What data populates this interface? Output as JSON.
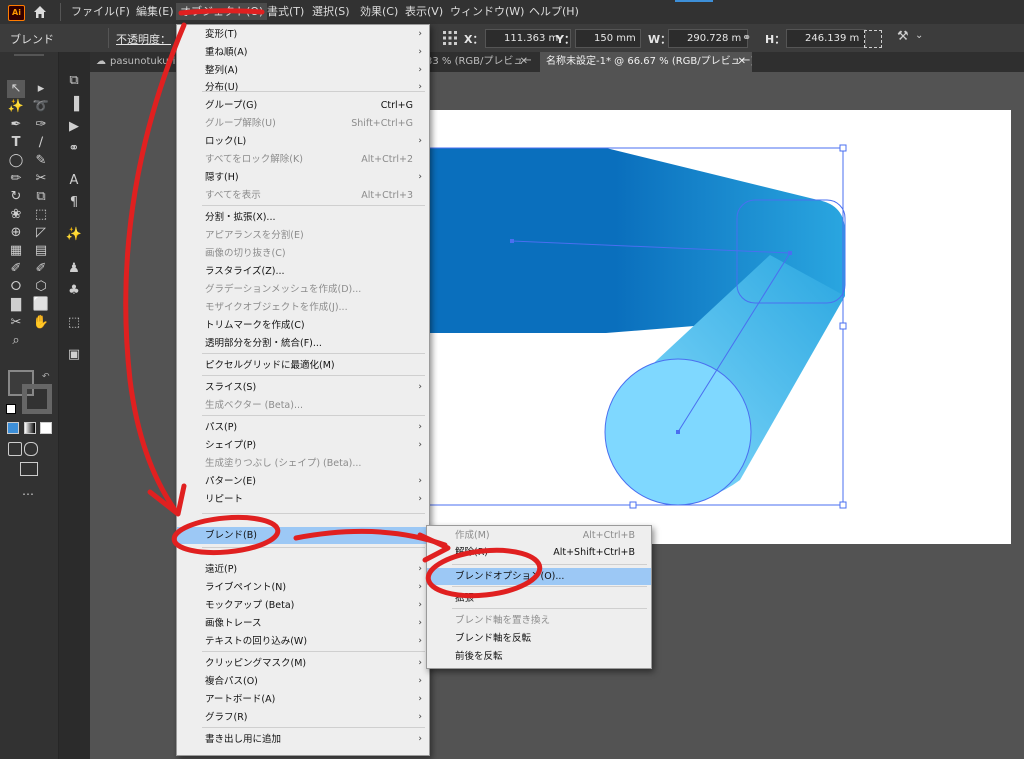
{
  "menubar": {
    "app_icon": "Ai",
    "items": [
      "ファイル(F)",
      "編集(E)",
      "オブジェクト(O)",
      "書式(T)",
      "選択(S)",
      "効果(C)",
      "表示(V)",
      "ウィンドウ(W)",
      "ヘルプ(H)"
    ]
  },
  "control_bar": {
    "mode_label": "ブレンド",
    "opacity_label": "不透明度：",
    "x_label": "X：",
    "x_value": "111.363 m",
    "y_label": "Y：",
    "y_value": "150 mm",
    "w_label": "W：",
    "w_value": "290.728 m",
    "h_label": "H：",
    "h_value": "246.139 m"
  },
  "tabs": [
    {
      "label": "pasunotukuri",
      "active": false
    },
    {
      "label": "33 % (RGB/プレビュー)",
      "active": false
    },
    {
      "label": "名称未設定-1* @ 66.67 % (RGB/プレビュー)",
      "active": true
    }
  ],
  "object_menu": {
    "items": [
      {
        "label": "変形(T)",
        "shortcut": "",
        "submenu": true,
        "disabled": false
      },
      {
        "label": "重ね順(A)",
        "shortcut": "",
        "submenu": true,
        "disabled": false
      },
      {
        "label": "整列(A)",
        "shortcut": "",
        "submenu": true,
        "disabled": false
      },
      {
        "label": "分布(U)",
        "shortcut": "",
        "submenu": true,
        "disabled": false
      },
      {
        "label": "グループ(G)",
        "shortcut": "Ctrl+G",
        "submenu": false,
        "disabled": false
      },
      {
        "label": "グループ解除(U)",
        "shortcut": "Shift+Ctrl+G",
        "submenu": false,
        "disabled": true
      },
      {
        "label": "ロック(L)",
        "shortcut": "",
        "submenu": true,
        "disabled": false
      },
      {
        "label": "すべてをロック解除(K)",
        "shortcut": "Alt+Ctrl+2",
        "submenu": false,
        "disabled": true
      },
      {
        "label": "隠す(H)",
        "shortcut": "",
        "submenu": true,
        "disabled": false
      },
      {
        "label": "すべてを表示",
        "shortcut": "Alt+Ctrl+3",
        "submenu": false,
        "disabled": true
      },
      {
        "label": "分割・拡張(X)...",
        "shortcut": "",
        "submenu": false,
        "disabled": false
      },
      {
        "label": "アピアランスを分割(E)",
        "shortcut": "",
        "submenu": false,
        "disabled": true
      },
      {
        "label": "画像の切り抜き(C)",
        "shortcut": "",
        "submenu": false,
        "disabled": true
      },
      {
        "label": "ラスタライズ(Z)...",
        "shortcut": "",
        "submenu": false,
        "disabled": false
      },
      {
        "label": "グラデーションメッシュを作成(D)...",
        "shortcut": "",
        "submenu": false,
        "disabled": true
      },
      {
        "label": "モザイクオブジェクトを作成(J)...",
        "shortcut": "",
        "submenu": false,
        "disabled": true
      },
      {
        "label": "トリムマークを作成(C)",
        "shortcut": "",
        "submenu": false,
        "disabled": false
      },
      {
        "label": "透明部分を分割・統合(F)...",
        "shortcut": "",
        "submenu": false,
        "disabled": false
      },
      {
        "label": "ピクセルグリッドに最適化(M)",
        "shortcut": "",
        "submenu": false,
        "disabled": false
      },
      {
        "label": "スライス(S)",
        "shortcut": "",
        "submenu": true,
        "disabled": false
      },
      {
        "label": "生成ベクター (Beta)...",
        "shortcut": "",
        "submenu": false,
        "disabled": true
      },
      {
        "label": "パス(P)",
        "shortcut": "",
        "submenu": true,
        "disabled": false
      },
      {
        "label": "シェイプ(P)",
        "shortcut": "",
        "submenu": true,
        "disabled": false
      },
      {
        "label": "生成塗りつぶし (シェイプ) (Beta)...",
        "shortcut": "",
        "submenu": false,
        "disabled": true
      },
      {
        "label": "パターン(E)",
        "shortcut": "",
        "submenu": true,
        "disabled": false
      },
      {
        "label": "リピート",
        "shortcut": "",
        "submenu": true,
        "disabled": false
      },
      {
        "label": "ブレンド(B)",
        "shortcut": "",
        "submenu": true,
        "disabled": false,
        "highlighted": true
      },
      {
        "label": "遠近(P)",
        "shortcut": "",
        "submenu": true,
        "disabled": false
      },
      {
        "label": "ライブペイント(N)",
        "shortcut": "",
        "submenu": true,
        "disabled": false
      },
      {
        "label": "モックアップ (Beta)",
        "shortcut": "",
        "submenu": true,
        "disabled": false
      },
      {
        "label": "画像トレース",
        "shortcut": "",
        "submenu": true,
        "disabled": false
      },
      {
        "label": "テキストの回り込み(W)",
        "shortcut": "",
        "submenu": true,
        "disabled": false
      },
      {
        "label": "クリッピングマスク(M)",
        "shortcut": "",
        "submenu": true,
        "disabled": false
      },
      {
        "label": "複合パス(O)",
        "shortcut": "",
        "submenu": true,
        "disabled": false
      },
      {
        "label": "アートボード(A)",
        "shortcut": "",
        "submenu": true,
        "disabled": false
      },
      {
        "label": "グラフ(R)",
        "shortcut": "",
        "submenu": true,
        "disabled": false
      },
      {
        "label": "書き出し用に追加",
        "shortcut": "",
        "submenu": true,
        "disabled": false
      }
    ]
  },
  "blend_submenu": {
    "items": [
      {
        "label": "作成(M)",
        "shortcut": "Alt+Ctrl+B",
        "disabled": true
      },
      {
        "label": "解除(R)",
        "shortcut": "Alt+Shift+Ctrl+B",
        "disabled": false
      },
      {
        "label": "ブレンドオプション(O)...",
        "shortcut": "",
        "disabled": false,
        "highlighted": true
      },
      {
        "label": "拡張",
        "shortcut": "",
        "disabled": false
      },
      {
        "label": "ブレンド軸を置き換え",
        "shortcut": "",
        "disabled": true
      },
      {
        "label": "ブレンド軸を反転",
        "shortcut": "",
        "disabled": false
      },
      {
        "label": "前後を反転",
        "shortcut": "",
        "disabled": false
      }
    ]
  },
  "colors": {
    "ui_dark": "#323232",
    "menu_bg": "#eeeeee",
    "menu_highlight": "#9cc8f5",
    "shape_blue_dark": "#0a6fbd",
    "shape_blue_mid": "#2aa6e0",
    "shape_blue_light": "#8fe0ff",
    "selection": "#4a6ff0",
    "annotation_red": "#e02020"
  }
}
